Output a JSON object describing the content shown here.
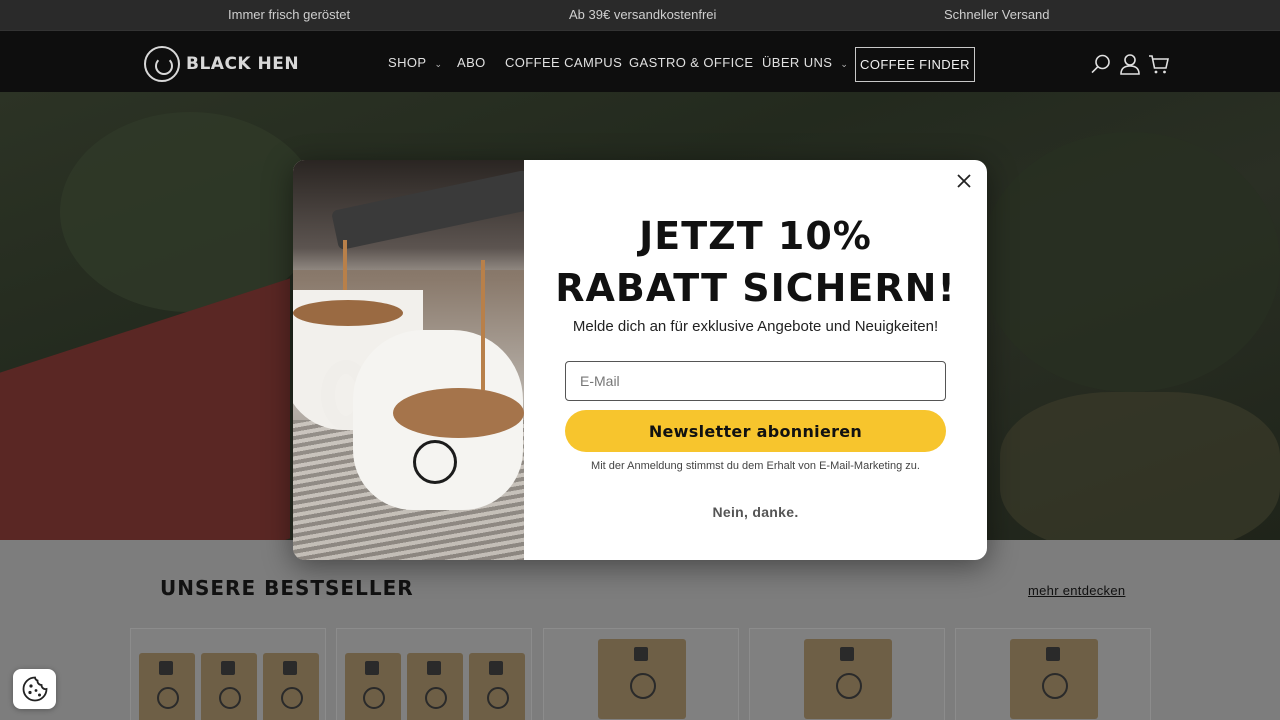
{
  "announcement": {
    "items": [
      "Immer frisch geröstet",
      "Ab 39€ versandkostenfrei",
      "Schneller Versand"
    ]
  },
  "header": {
    "logo_text": "BLACK HEN",
    "nav": [
      {
        "label": "SHOP",
        "has_dropdown": true
      },
      {
        "label": "ABO",
        "has_dropdown": false
      },
      {
        "label": "COFFEE CAMPUS",
        "has_dropdown": false
      },
      {
        "label": "GASTRO & OFFICE",
        "has_dropdown": false
      },
      {
        "label": "ÜBER UNS",
        "has_dropdown": true
      }
    ],
    "finder_label": "COFFEE FINDER",
    "icons": [
      "search-icon",
      "account-icon",
      "cart-icon"
    ]
  },
  "popup": {
    "headline_line1": "JETZT 10%",
    "headline_line2": "RABATT SICHERN!",
    "subline": "Melde dich an für exklusive Angebote und Neuigkeiten!",
    "email_placeholder": "E-Mail",
    "email_value": "",
    "subscribe_label": "Newsletter abonnieren",
    "consent_text": "Mit der Anmeldung stimmst du dem Erhalt von E-Mail-Marketing zu.",
    "decline_label": "Nein, danke.",
    "accent_color": "#f7c52d"
  },
  "bestsellers": {
    "title": "UNSERE BESTSELLER",
    "more_link": "mehr entdecken"
  }
}
